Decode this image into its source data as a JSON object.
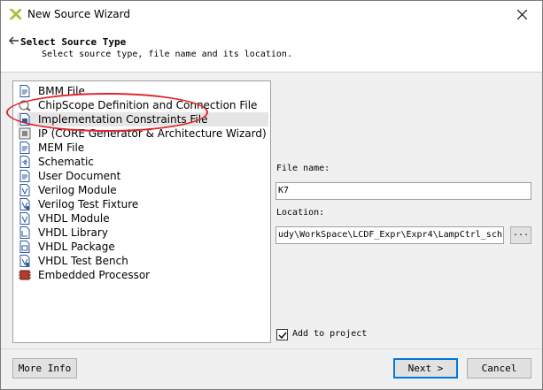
{
  "window": {
    "title": "New Source Wizard",
    "close_glyph": "✕"
  },
  "header": {
    "back_glyph": "🡐",
    "title": "Select Source Type",
    "subtitle": "Select source type, file name and its location."
  },
  "source_types": [
    {
      "label": "BMM File",
      "icon": "doc-icon"
    },
    {
      "label": "ChipScope Definition and Connection File",
      "icon": "chipscope-icon"
    },
    {
      "label": "Implementation Constraints File",
      "icon": "constraints-doc-icon",
      "selected": true
    },
    {
      "label": "IP (CORE Generator & Architecture Wizard)",
      "icon": "ip-core-icon"
    },
    {
      "label": "MEM File",
      "icon": "doc-icon"
    },
    {
      "label": "Schematic",
      "icon": "schematic-icon"
    },
    {
      "label": "User Document",
      "icon": "doc-icon"
    },
    {
      "label": "Verilog Module",
      "icon": "verilog-module-icon"
    },
    {
      "label": "Verilog Test Fixture",
      "icon": "verilog-fixture-icon"
    },
    {
      "label": "VHDL Module",
      "icon": "vhdl-module-icon"
    },
    {
      "label": "VHDL Library",
      "icon": "vhdl-library-icon"
    },
    {
      "label": "VHDL Package",
      "icon": "vhdl-package-icon"
    },
    {
      "label": "VHDL Test Bench",
      "icon": "vhdl-testbench-icon"
    },
    {
      "label": "Embedded Processor",
      "icon": "processor-icon"
    }
  ],
  "form": {
    "file_name_label": "File name:",
    "file_name_value": "K7",
    "location_label": "Location:",
    "location_value": "udy\\WorkSpace\\LCDF_Expr\\Expr4\\LampCtrl_sch",
    "browse_label": "...",
    "add_to_project_label": "Add to project",
    "add_to_project_checked": true
  },
  "footer": {
    "more_info_label": "More Info",
    "next_label": "Next >",
    "cancel_label": "Cancel"
  },
  "colors": {
    "highlight_annotation": "#e0262d",
    "default_button_border": "#0078d7",
    "selection_background": "#e5e5e5"
  }
}
